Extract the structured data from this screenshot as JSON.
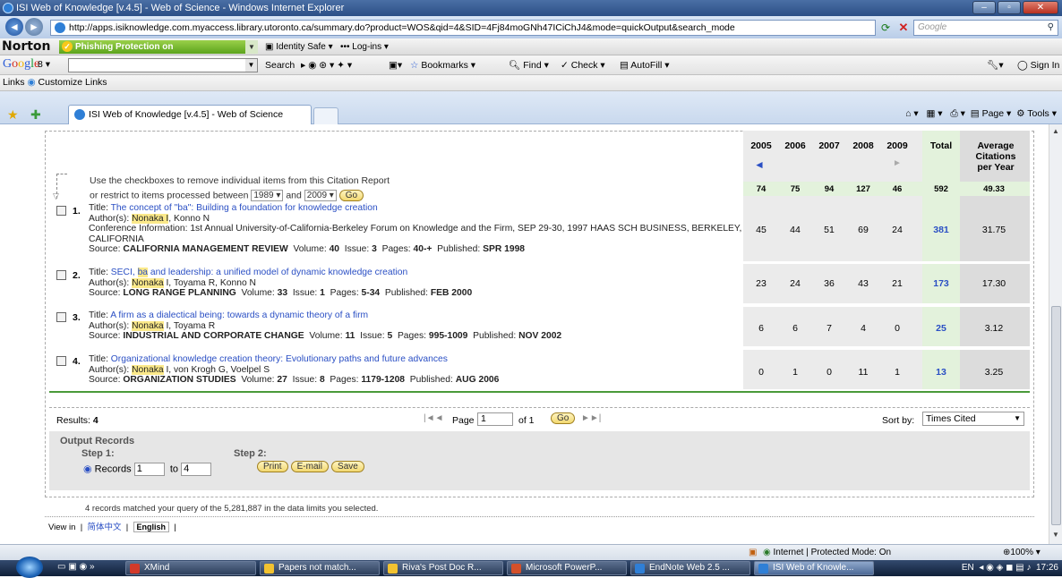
{
  "window": {
    "title": "ISI Web of Knowledge [v.4.5] - Web of Science - Windows Internet Explorer"
  },
  "address": {
    "url": "http://apps.isiknowledge.com.myaccess.library.utoronto.ca/summary.do?product=WOS&qid=4&SID=4Fj84moGNh47ICiChJ4&mode=quickOutput&search_mode",
    "search_placeholder": "Google"
  },
  "norton": {
    "logo": "Norton",
    "phishing": "Phishing Protection on",
    "identity": "Identity Safe ▾",
    "logins": "Log-ins ▾"
  },
  "google": {
    "logo_g": "Google",
    "account": "8 ▾",
    "search": "Search",
    "bookmarks": "Bookmarks ▾",
    "find": "Find ▾",
    "check": "Check ▾",
    "autofill": "AutoFill ▾",
    "signin": "Sign In ▾"
  },
  "links": {
    "label": "Links",
    "item": "Customize Links"
  },
  "tab": {
    "title": "ISI Web of Knowledge [v.4.5] - Web of Science",
    "page": "Page ▾",
    "tools": "Tools ▾"
  },
  "report": {
    "instr1": "Use the checkboxes to remove individual items from this Citation Report",
    "instr2_a": "or restrict to items processed between",
    "from_year": "1989",
    "and": "and",
    "to_year": "2009",
    "go": "Go",
    "years": [
      "2005",
      "2006",
      "2007",
      "2008",
      "2009"
    ],
    "total_label": "Total",
    "avg_label": "Average Citations per Year",
    "prev_arrow": "◄",
    "next_arrow": "►",
    "totals": [
      "74",
      "75",
      "94",
      "127",
      "46",
      "592",
      "49.33"
    ]
  },
  "records": [
    {
      "num": "1.",
      "title": "The concept of \"ba\": Building a foundation for knowledge creation",
      "authors_pre": "Author(s): ",
      "authors_hl": "Nonaka I",
      "authors_post": ", Konno N",
      "conf": "Conference Information: 1st Annual University-of-California-Berkeley Forum on Knowledge and the Firm, SEP 29-30, 1997 HAAS SCH BUSINESS, BERKELEY, CALIFORNIA",
      "source_name": "CALIFORNIA MANAGEMENT REVIEW",
      "volume": "40",
      "issue": "3",
      "pages": "40-+",
      "published": "SPR 1998",
      "counts": [
        "45",
        "44",
        "51",
        "69",
        "24"
      ],
      "total": "381",
      "avg": "31.75"
    },
    {
      "num": "2.",
      "title_pre": "SECI, ",
      "title_hl": "ba",
      "title_post": " and leadership: a unified model of dynamic knowledge creation",
      "authors_pre": "Author(s): ",
      "authors_hl": "Nonaka",
      "authors_post": " I, Toyama R, Konno N",
      "source_name": "LONG RANGE PLANNING",
      "volume": "33",
      "issue": "1",
      "pages": "5-34",
      "published": "FEB 2000",
      "counts": [
        "23",
        "24",
        "36",
        "43",
        "21"
      ],
      "total": "173",
      "avg": "17.30"
    },
    {
      "num": "3.",
      "title": "A firm as a dialectical being: towards a dynamic theory of a firm",
      "authors_pre": "Author(s): ",
      "authors_hl": "Nonaka",
      "authors_post": " I, Toyama R",
      "source_name": "INDUSTRIAL AND CORPORATE CHANGE",
      "volume": "11",
      "issue": "5",
      "pages": "995-1009",
      "published": "NOV 2002",
      "counts": [
        "6",
        "6",
        "7",
        "4",
        "0"
      ],
      "total": "25",
      "avg": "3.12"
    },
    {
      "num": "4.",
      "title": "Organizational knowledge creation theory: Evolutionary paths and future advances",
      "authors_pre": "Author(s): ",
      "authors_hl": "Nonaka",
      "authors_post": " I, von Krogh G, Voelpel S",
      "source_name": "ORGANIZATION STUDIES",
      "volume": "27",
      "issue": "8",
      "pages": "1179-1208",
      "published": "AUG 2006",
      "counts": [
        "0",
        "1",
        "0",
        "11",
        "1"
      ],
      "total": "13",
      "avg": "3.25"
    }
  ],
  "labels": {
    "title": "Title: ",
    "source": "Source: ",
    "volume": "Volume: ",
    "issue": "Issue: ",
    "pages": "Pages: ",
    "published": "Published: "
  },
  "results": {
    "label": "Results: ",
    "count": "4",
    "page_label": "Page",
    "page_value": "1",
    "of": "of 1",
    "go": "Go",
    "sort_label": "Sort by:",
    "sort_value": "Times Cited"
  },
  "output": {
    "heading": "Output Records",
    "step1": "Step 1:",
    "step2": "Step 2:",
    "records_label": "Records",
    "from": "1",
    "to_label": "to",
    "to": "4",
    "print": "Print",
    "email": "E-mail",
    "save": "Save"
  },
  "footer": {
    "matched": "4 records matched your query of the 5,281,887 in the data limits you selected.",
    "view_in": "View in",
    "lang_cn": "简体中文",
    "lang_en": "English"
  },
  "status": {
    "zone": "Internet | Protected Mode: On",
    "zoom": "100%"
  },
  "taskbar": {
    "buttons": [
      "XMind",
      "Papers not match...",
      "Riva's Post Doc R...",
      "Microsoft PowerP...",
      "EndNote Web 2.5 ...",
      "ISI Web of Knowle..."
    ],
    "lang": "EN",
    "time": "17:26"
  }
}
